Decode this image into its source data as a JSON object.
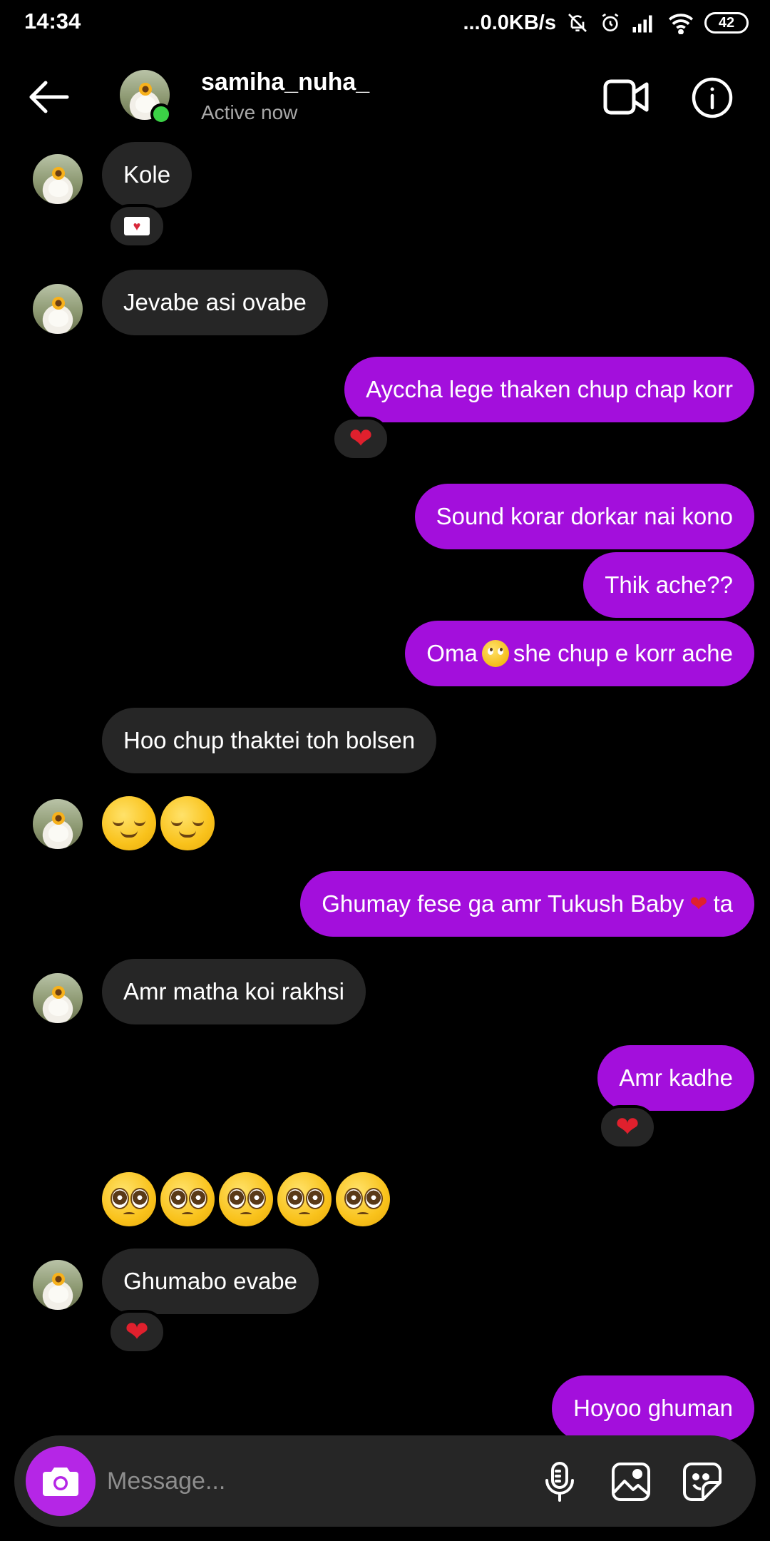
{
  "status_bar": {
    "time": "14:34",
    "network_speed": "...0.0KB/s",
    "battery": "42",
    "icons": [
      "mute-bell-icon",
      "alarm-icon",
      "signal-icon",
      "wifi-icon",
      "battery-icon"
    ]
  },
  "header": {
    "username": "samiha_nuha_",
    "status": "Active now",
    "icons": [
      "back-arrow-icon",
      "video-call-icon",
      "info-icon"
    ]
  },
  "messages": {
    "m1": "Kole",
    "m2": "Jevabe asi ovabe",
    "m3": "Ayccha lege thaken chup chap korr",
    "m4": "Sound korar dorkar nai kono",
    "m5": "Thik ache??",
    "m6_pre": "Oma",
    "m6_post": "she chup e korr ache",
    "m7": "Hoo chup thaktei toh bolsen",
    "m9_pre": "Ghumay fese ga amr Tukush Baby",
    "m9_post": "ta",
    "m10": "Amr matha koi rakhsi",
    "m11": "Amr kadhe",
    "m13": "Ghumabo evabe",
    "m14": "Hoyoo ghuman"
  },
  "reactions": {
    "heart": "❤",
    "envelope_heart": "♥"
  },
  "composer": {
    "placeholder": "Message..."
  },
  "colors": {
    "outgoing_bubble": "#a30fdc",
    "incoming_bubble": "#262626",
    "camera_button": "#b526e6",
    "online": "#3bd146"
  }
}
